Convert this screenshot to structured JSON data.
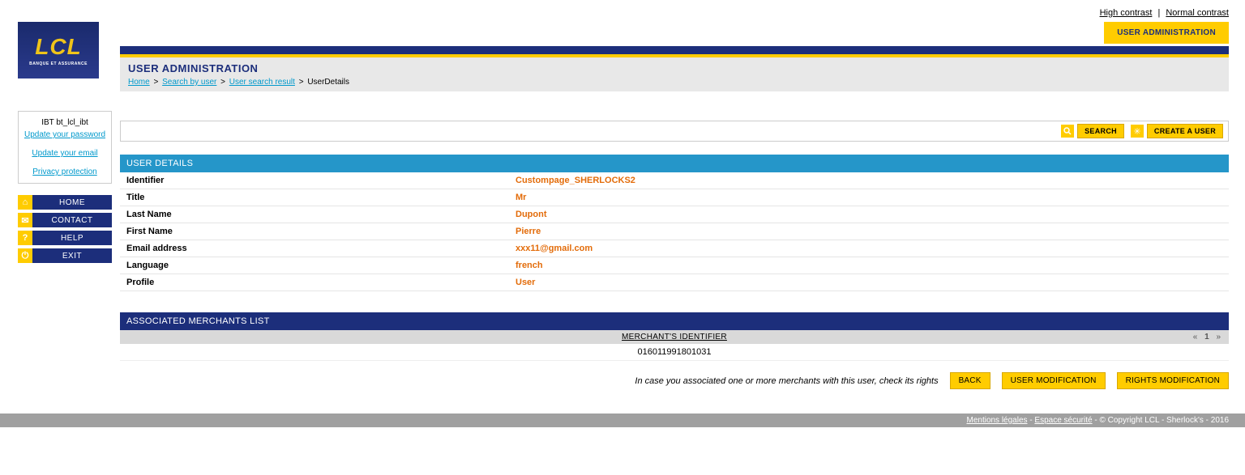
{
  "top": {
    "high_contrast": "High contrast",
    "normal_contrast": "Normal contrast"
  },
  "logo": {
    "text": "LCL",
    "sub": "BANQUE ET ASSURANCE"
  },
  "tab": {
    "active": "USER ADMINISTRATION"
  },
  "section": {
    "title": "USER ADMINISTRATION"
  },
  "breadcrumb": {
    "home": "Home",
    "search_by_user": "Search by user",
    "user_search_result": "User search result",
    "current": "UserDetails"
  },
  "userbox": {
    "name": "IBT bt_lcl_ibt",
    "update_password": "Update your password",
    "update_email": "Update your email",
    "privacy": "Privacy protection"
  },
  "nav": {
    "home": "HOME",
    "contact": "CONTACT",
    "help": "HELP",
    "exit": "EXIT"
  },
  "actions": {
    "search": "SEARCH",
    "create_user": "CREATE A USER"
  },
  "user_details": {
    "heading": "USER DETAILS",
    "rows": {
      "identifier_label": "Identifier",
      "identifier_value": "Custompage_SHERLOCKS2",
      "title_label": "Title",
      "title_value": "Mr",
      "lastname_label": "Last Name",
      "lastname_value": "Dupont",
      "firstname_label": "First Name",
      "firstname_value": "Pierre",
      "email_label": "Email address",
      "email_value": "xxx11@gmail.com",
      "language_label": "Language",
      "language_value": "french",
      "profile_label": "Profile",
      "profile_value": "User"
    }
  },
  "merchants": {
    "heading": "ASSOCIATED MERCHANTS LIST",
    "col_header": "MERCHANT'S IDENTIFIER",
    "row1": "016011991801031",
    "page": "1"
  },
  "buttons": {
    "hint": "In case you associated one or more merchants with this user, check its rights",
    "back": "BACK",
    "user_modification": "USER MODIFICATION",
    "rights_modification": "RIGHTS MODIFICATION"
  },
  "footer": {
    "mentions": "Mentions légales",
    "espace": "Espace sécurité",
    "copyright": " - © Copyright LCL - Sherlock's - 2016"
  }
}
